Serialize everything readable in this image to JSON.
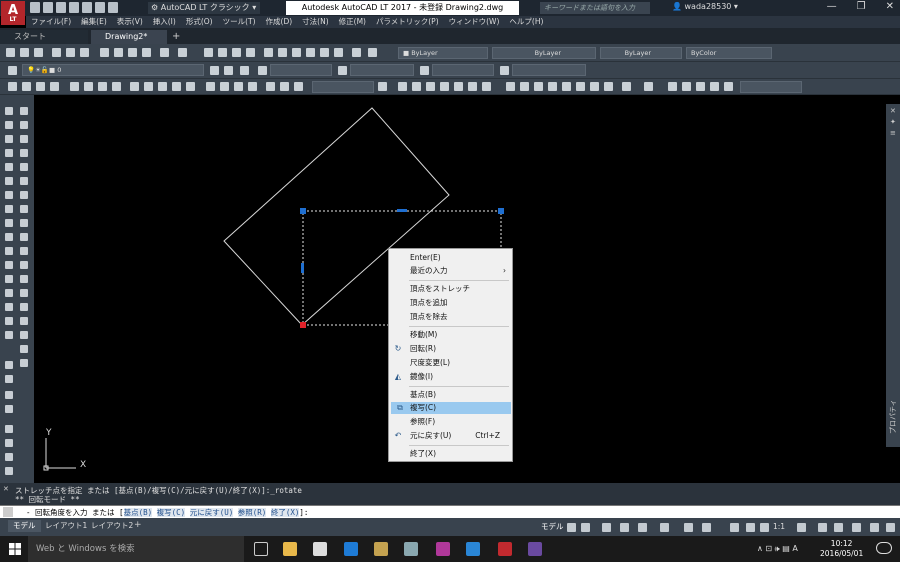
{
  "titlebar": {
    "logo": "A",
    "logo_sub": "LT",
    "workspace": "AutoCAD LT クラシック",
    "window_title": "Autodesk AutoCAD LT 2017 - 未登録   Drawing2.dwg",
    "search_placeholder": "キーワードまたは語句を入力",
    "user": "wada28530"
  },
  "menubar": [
    "ファイル(F)",
    "編集(E)",
    "表示(V)",
    "挿入(I)",
    "形式(O)",
    "ツール(T)",
    "作成(D)",
    "寸法(N)",
    "修正(M)",
    "パラメトリック(P)",
    "ウィンドウ(W)",
    "ヘルプ(H)"
  ],
  "tabs": {
    "start": "スタート",
    "active": "Drawing2*"
  },
  "toolbar": {
    "layer_current": "0",
    "color": "ByLayer",
    "linetype": "ByLayer",
    "lineweight": "ByLayer",
    "plotstyle": "ByColor"
  },
  "canvas": {
    "ucs_x": "X",
    "ucs_y": "Y"
  },
  "context_menu": {
    "items": [
      {
        "label": "Enter(E)"
      },
      {
        "label": "最近の入力",
        "submenu": true
      },
      {
        "label": "頂点をストレッチ"
      },
      {
        "label": "頂点を追加"
      },
      {
        "label": "頂点を除去"
      },
      {
        "label": "移動(M)"
      },
      {
        "label": "回転(R)",
        "icon": "rotate-icon"
      },
      {
        "label": "尺度変更(L)"
      },
      {
        "label": "鏡像(I)",
        "icon": "mirror-icon"
      },
      {
        "label": "基点(B)"
      },
      {
        "label": "複写(C)",
        "icon": "copy-icon",
        "highlighted": true
      },
      {
        "label": "参照(F)"
      },
      {
        "label": "元に戻す(U)",
        "shortcut": "Ctrl+Z",
        "icon": "undo-icon"
      },
      {
        "label": "終了(X)"
      }
    ]
  },
  "command": {
    "history_1": "ストレッチ点を指定 または [基点(B)/複写(C)/元に戻す(U)/終了(X)]:_rotate",
    "history_2": "** 回転モード **",
    "prompt": "- 回転角度を入力 または [",
    "opt_base": "基点(B)",
    "opt_copy": "複写(C)",
    "opt_undo": "元に戻す(U)",
    "opt_ref": "参照(R)",
    "opt_exit": "終了(X)",
    "suffix": "]:"
  },
  "statusbar": {
    "tabs": [
      "モデル",
      "レイアウト1",
      "レイアウト2"
    ],
    "mode": "モデル",
    "scale": "1:1"
  },
  "taskbar": {
    "search": "Web と Windows を検索",
    "time": "10:12",
    "date": "2016/05/01",
    "ime": "A"
  },
  "right_palette": {
    "label": "プロパティ"
  }
}
